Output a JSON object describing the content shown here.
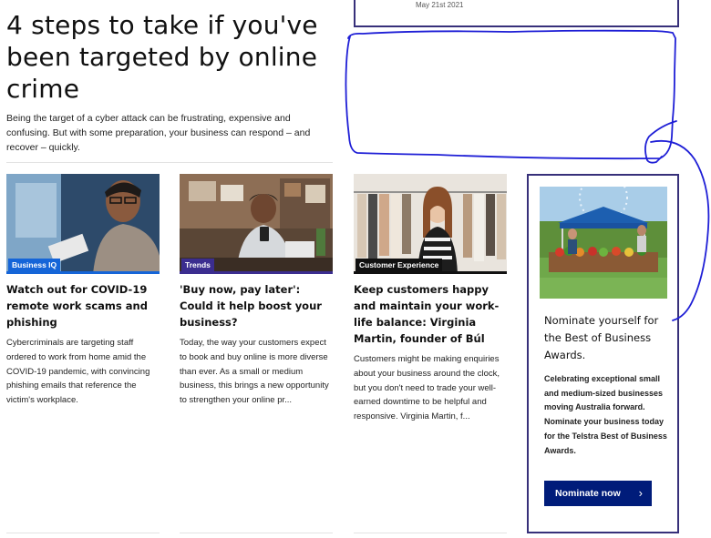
{
  "hero": {
    "title": "4 steps to take if you've been targeted by online crime",
    "summary": "Being the target of a cyber attack can be frustrating, expensive and confusing. But with some preparation, your business can respond – and recover – quickly."
  },
  "top_card": {
    "date": "May 21st 2021"
  },
  "cards": [
    {
      "tag": "Business IQ",
      "tag_color": "#1565d8",
      "title": "Watch out for COVID-19 remote work scams and phishing",
      "excerpt": "Cybercriminals are targeting staff ordered to work from home amid the COVID-19 pandemic, with convincing phishing emails that reference the victim's workplace."
    },
    {
      "tag": "Trends",
      "tag_color": "#3b2d8f",
      "title": "'Buy now, pay later': Could it help boost your business?",
      "excerpt": "Today, the way your customers expect to book and buy online is more diverse than ever. As a small or medium business, this brings a new opportunity to strengthen your online pr..."
    },
    {
      "tag": "Customer Experience",
      "tag_color": "#111111",
      "title": "Keep customers happy and maintain your work-life balance: Virginia Martin, founder of Búl",
      "excerpt": "Customers might be making enquiries about your business around the clock, but you don't need to trade your well-earned downtime to be helpful and responsive. Virginia Martin, f..."
    }
  ],
  "promo": {
    "title": "Nominate yourself for the Best of Business Awards.",
    "body": "Celebrating exceptional small and medium-sized businesses moving Australia forward. Nominate your business today for the Telstra Best of Business Awards.",
    "button_label": "Nominate now",
    "button_color": "#001c7a",
    "chevron": "›"
  },
  "colors": {
    "accent": "#37307a",
    "scribble": "#1f1fd6"
  }
}
